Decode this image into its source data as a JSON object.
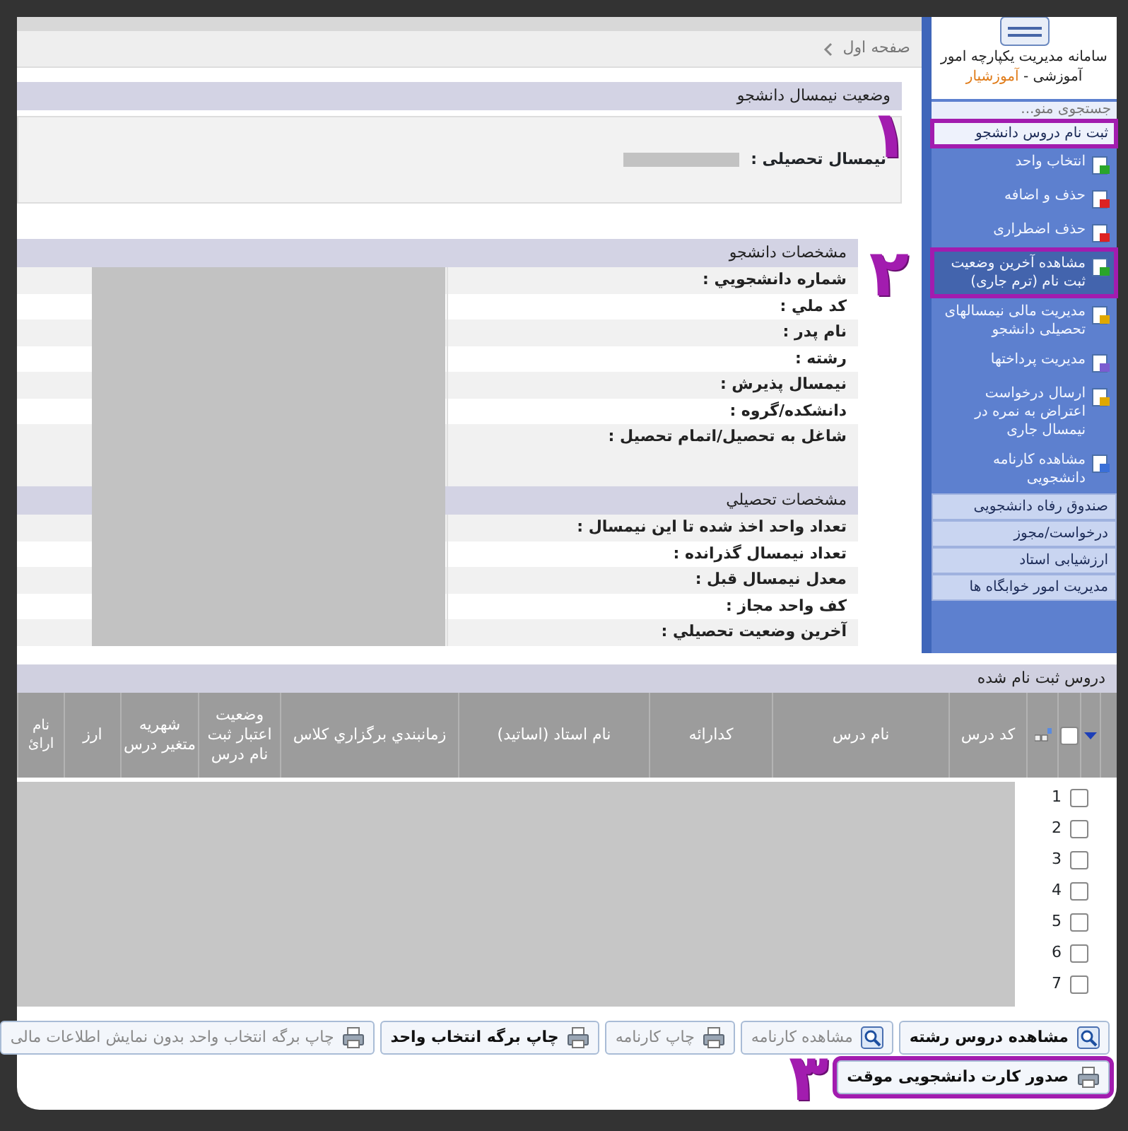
{
  "sidebar": {
    "title": "سامانه مدیریت یکپارچه امور",
    "subtitle": "آموزشی -",
    "brand": "آموزشیار",
    "search": {
      "placeholder": "جستجوی منو..."
    },
    "groups": [
      {
        "label": "ثبت نام دروس دانشجو",
        "expanded": true,
        "highlighted": true,
        "marker": "۱",
        "items": [
          {
            "label": "انتخاب واحد",
            "selected": false,
            "highlighted": false
          },
          {
            "label": "حذف و اضافه",
            "selected": false,
            "highlighted": false
          },
          {
            "label": "حذف اضطراری",
            "selected": false,
            "highlighted": false
          },
          {
            "label": "مشاهده آخرین وضعیت ثبت نام (ترم جاری)",
            "selected": true,
            "highlighted": true,
            "marker": "۲"
          },
          {
            "label": "مدیریت مالی نیمسالهای تحصیلی دانشجو",
            "selected": false,
            "highlighted": false
          },
          {
            "label": "مدیریت پرداختها",
            "selected": false,
            "highlighted": false
          },
          {
            "label": "ارسال درخواست اعتراض به نمره در نیمسال جاری",
            "selected": false,
            "highlighted": false
          },
          {
            "label": "مشاهده کارنامه دانشجویی",
            "selected": false,
            "highlighted": false
          }
        ]
      },
      {
        "label": "صندوق رفاه دانشجویی",
        "expanded": false,
        "highlighted": false
      },
      {
        "label": "درخواست/مجوز",
        "expanded": false,
        "highlighted": false
      },
      {
        "label": "ارزشیابی استاد",
        "expanded": false,
        "highlighted": false
      },
      {
        "label": "مدیریت امور خوابگاه ها",
        "expanded": false,
        "highlighted": false
      }
    ]
  },
  "breadcrumb": {
    "label": "صفحه اول"
  },
  "semester_section": {
    "title": "وضعیت نیمسال دانشجو",
    "field": {
      "label": "نیمسال تحصیلی :",
      "redacted": true
    }
  },
  "details_redacted": true,
  "details_sections": [
    {
      "title": "مشخصات دانشجو",
      "rows": [
        "شماره دانشجویي :",
        "کد ملي :",
        "نام پدر :",
        "رشته :",
        "نیمسال پذیرش :",
        "دانشکده/گروه :",
        "شاغل به تحصیل/اتمام تحصیل :"
      ]
    },
    {
      "title": "مشخصات تحصیلي",
      "rows": [
        "تعداد واحد اخذ شده تا این نیمسال :",
        "تعداد نیمسال گذرانده :",
        "معدل نیمسال قبل :",
        "کف واحد مجاز :",
        "آخرین وضعیت تحصیلي :"
      ]
    }
  ],
  "registered_courses": {
    "title": "دروس ثبت نام شده",
    "header_checked": false,
    "columns": [
      "کد درس",
      "نام درس",
      "کدارائه",
      "نام استاد (اساتید)",
      "زمانبندي برگزاري کلاس",
      "وضعیت اعتبار ثبت نام درس",
      "شهریه متغیر درس",
      "ارز",
      "نام ارائ"
    ],
    "rows": [
      {
        "number": "1",
        "checked": false
      },
      {
        "number": "2",
        "checked": false
      },
      {
        "number": "3",
        "checked": false
      },
      {
        "number": "4",
        "checked": false
      },
      {
        "number": "5",
        "checked": false
      },
      {
        "number": "6",
        "checked": false
      },
      {
        "number": "7",
        "checked": false
      }
    ],
    "redacted": true
  },
  "button_rows": [
    {
      "buttons": [
        {
          "label": "مشاهده دروس رشته",
          "kind": "view",
          "disabled": false,
          "highlighted": false
        },
        {
          "label": "مشاهده کارنامه",
          "kind": "view",
          "disabled": true,
          "highlighted": false
        },
        {
          "label": "چاپ کارنامه",
          "kind": "print",
          "disabled": true,
          "highlighted": false
        },
        {
          "label": "چاپ برگه انتخاب واحد",
          "kind": "print",
          "disabled": false,
          "highlighted": false
        },
        {
          "label": "چاپ برگه انتخاب واحد بدون نمایش اطلاعات مالی",
          "kind": "print",
          "disabled": true,
          "highlighted": false
        }
      ]
    },
    {
      "buttons": [
        {
          "label": "صدور کارت دانشجویی موقت",
          "kind": "print",
          "disabled": false,
          "highlighted": true,
          "marker": "۳"
        }
      ]
    }
  ]
}
